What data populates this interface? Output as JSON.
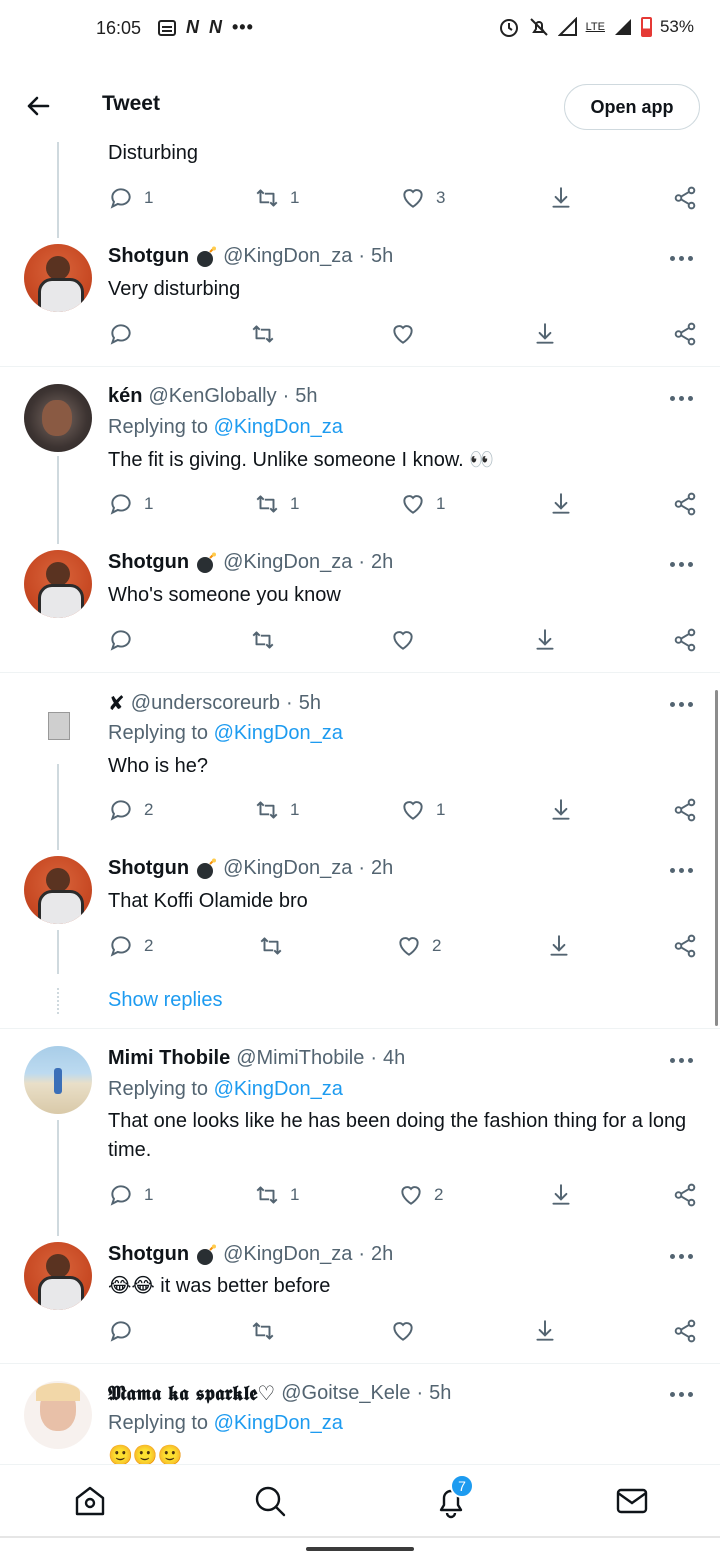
{
  "status_bar": {
    "time": "16:05",
    "left_icons": [
      "message-icon",
      "n-app-icon",
      "n-app-icon",
      "more-dots-icon"
    ],
    "right_icons": [
      "alarm-icon",
      "mute-icon",
      "signal-icon",
      "lte-icon",
      "signal-icon",
      "battery-icon"
    ],
    "lte": "LTE",
    "battery": "53%"
  },
  "header": {
    "title": "Tweet",
    "open_app": "Open app"
  },
  "tweets": [
    {
      "text": "Disturbing",
      "stats": {
        "replies": "1",
        "retweets": "1",
        "likes": "3"
      }
    },
    {
      "name": "Shotgun",
      "handle": "@KingDon_za",
      "sep": "·",
      "time": "5h",
      "text": "Very disturbing",
      "stats": {
        "replies": "",
        "retweets": "",
        "likes": ""
      }
    },
    {
      "name": "kén",
      "handle": "@KenGlobally",
      "sep": "·",
      "time": "5h",
      "replying_to": "Replying to",
      "mention": "@KingDon_za",
      "text": "The fit is giving. Unlike someone I know. 👀",
      "stats": {
        "replies": "1",
        "retweets": "1",
        "likes": "1"
      }
    },
    {
      "name": "Shotgun",
      "handle": "@KingDon_za",
      "sep": "·",
      "time": "2h",
      "text": "Who's someone you know",
      "stats": {
        "replies": "",
        "retweets": "",
        "likes": ""
      }
    },
    {
      "name": "✘",
      "handle": "@underscoreurb",
      "sep": "·",
      "time": "5h",
      "replying_to": "Replying to",
      "mention": "@KingDon_za",
      "text": "Who is he?",
      "stats": {
        "replies": "2",
        "retweets": "1",
        "likes": "1"
      }
    },
    {
      "name": "Shotgun",
      "handle": "@KingDon_za",
      "sep": "·",
      "time": "2h",
      "text": "That Koffi Olamide bro",
      "stats": {
        "replies": "2",
        "retweets": "",
        "likes": "2"
      }
    },
    {
      "name": "Mimi Thobile",
      "handle": "@MimiThobile",
      "sep": "·",
      "time": "4h",
      "replying_to": "Replying to",
      "mention": "@KingDon_za",
      "text": "That one looks like he has been doing the fashion thing for a long time.",
      "stats": {
        "replies": "1",
        "retweets": "1",
        "likes": "2"
      }
    },
    {
      "name": "Shotgun",
      "handle": "@KingDon_za",
      "sep": "·",
      "time": "2h",
      "text": "😂😂 it was better before",
      "stats": {
        "replies": "",
        "retweets": "",
        "likes": ""
      }
    },
    {
      "name": "𝕸𝖆𝖒𝖆 𝖐𝖆 𝖘𝖕𝖆𝖗𝖐𝖑𝖊♡",
      "handle": "@Goitse_Kele",
      "sep": "·",
      "time": "5h",
      "replying_to": "Replying to",
      "mention": "@KingDon_za",
      "text": "🙂🙂🙂"
    }
  ],
  "show_replies": "Show replies",
  "bottom_nav": {
    "items": [
      "home-icon",
      "search-icon",
      "notifications-icon",
      "messages-icon"
    ],
    "notification_count": "7"
  },
  "colors": {
    "accent": "#1d9bf0",
    "text": "#0f1419",
    "muted": "#536471",
    "divider": "#eff3f4"
  }
}
